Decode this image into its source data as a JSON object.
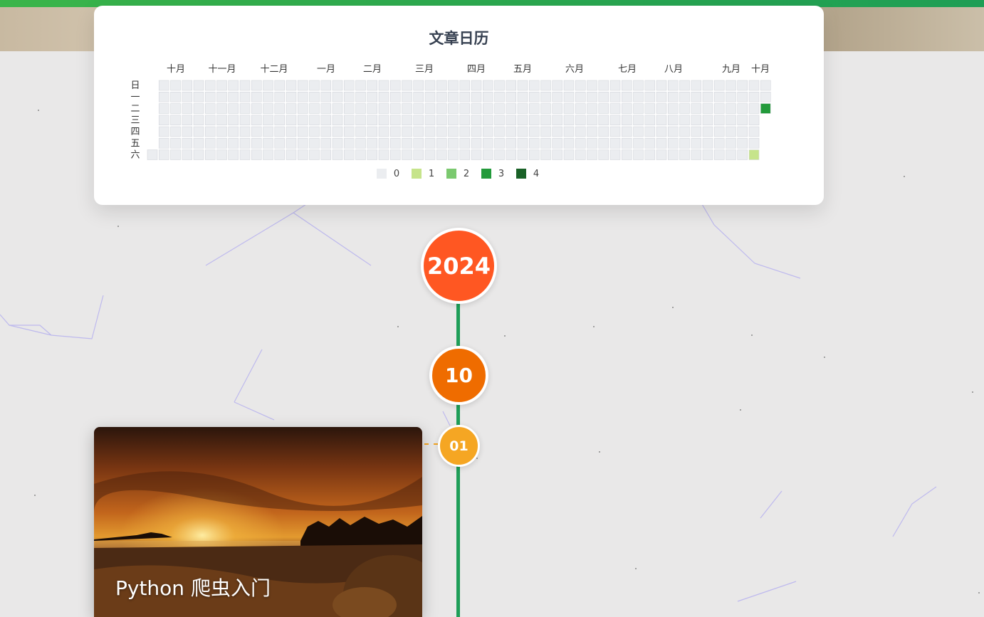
{
  "calendar": {
    "title": "文章日历",
    "months": [
      "十月",
      "十一月",
      "十二月",
      "一月",
      "二月",
      "三月",
      "四月",
      "五月",
      "六月",
      "七月",
      "八月",
      "九月",
      "十月"
    ],
    "weekdays": [
      "日",
      "一",
      "二",
      "三",
      "四",
      "五",
      "六"
    ],
    "legend_levels": [
      "0",
      "1",
      "2",
      "3",
      "4"
    ],
    "colors": {
      "empty": "#ebedf0",
      "level1": "#c6e48b",
      "level2": "#7bc96f",
      "level3": "#239a3b",
      "level4": "#196127"
    },
    "active_days": [
      {
        "week": 53,
        "weekday": 2,
        "level": 3
      },
      {
        "week": 52,
        "weekday": 6,
        "level": 1
      }
    ]
  },
  "timeline": {
    "year": "2024",
    "month": "10",
    "day": "01",
    "colors": {
      "line": "#1f9e58",
      "year": "#ff5722",
      "month": "#ef6c00",
      "day": "#f5a623"
    }
  },
  "post": {
    "title": "Python 爬虫入门",
    "cover_icon": "sunset-landscape-image"
  }
}
